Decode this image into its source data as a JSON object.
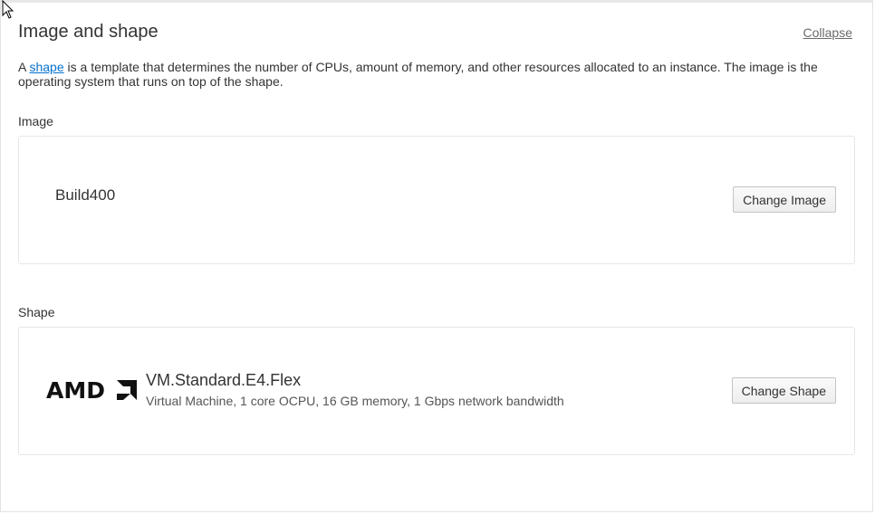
{
  "section": {
    "title": "Image and shape",
    "collapse_label": "Collapse"
  },
  "description": {
    "prefix": "A ",
    "link_text": "shape",
    "suffix": " is a template that determines the number of CPUs, amount of memory, and other resources allocated to an instance. The image is the operating system that runs on top of the shape."
  },
  "image": {
    "label": "Image",
    "name": "Build400",
    "change_button": "Change Image"
  },
  "shape": {
    "label": "Shape",
    "vendor_logo": "AMD",
    "name": "VM.Standard.E4.Flex",
    "details": "Virtual Machine, 1 core OCPU, 16 GB memory, 1 Gbps network bandwidth",
    "change_button": "Change Shape"
  },
  "icons": {
    "cursor": "mouse-pointer-icon",
    "vendor": "amd-logo-icon"
  },
  "colors": {
    "link": "#0572ce",
    "text": "#333333",
    "border": "#e6e6e6"
  }
}
